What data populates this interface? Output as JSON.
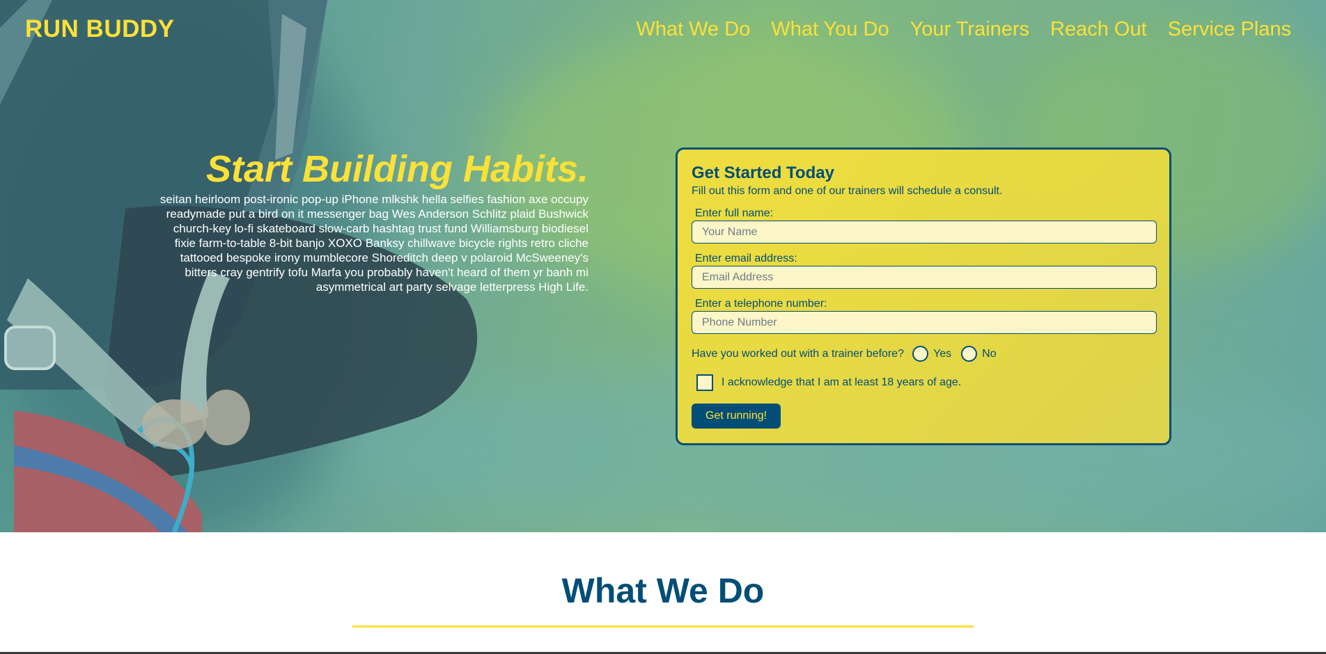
{
  "brand": {
    "logo_text": "RUN BUDDY",
    "accent_color": "#fce138",
    "primary_color": "#024e76"
  },
  "nav": {
    "items": [
      {
        "label": "What We Do"
      },
      {
        "label": "What You Do"
      },
      {
        "label": "Your Trainers"
      },
      {
        "label": "Reach Out"
      },
      {
        "label": "Service Plans"
      }
    ]
  },
  "hero": {
    "image_icon": "runner-tying-shoe-photo",
    "headline": "Start Building Habits.",
    "body": "seitan heirloom post-ironic pop-up iPhone mlkshk hella selfies fashion axe occupy readymade put a bird on it messenger bag Wes Anderson Schlitz plaid Bushwick church-key lo-fi skateboard slow-carb hashtag trust fund Williamsburg biodiesel fixie farm-to-table 8-bit banjo XOXO Banksy chillwave bicycle rights retro cliche tattooed bespoke irony mumblecore Shoreditch deep v polaroid McSweeney's bitters cray gentrify tofu Marfa you probably haven't heard of them yr banh mi asymmetrical art party selvage letterpress High Life."
  },
  "form": {
    "title": "Get Started Today",
    "subtitle": "Fill out this form and one of our trainers will schedule a consult.",
    "name_label": "Enter full name:",
    "name_placeholder": "Your Name",
    "name_value": "",
    "email_label": "Enter email address:",
    "email_placeholder": "Email Address",
    "email_value": "",
    "phone_label": "Enter a telephone number:",
    "phone_placeholder": "Phone Number",
    "phone_value": "",
    "trainer_question": "Have you worked out with a trainer before?",
    "radio_yes": "Yes",
    "radio_no": "No",
    "age_ack": "I acknowledge that I am at least 18 years of age.",
    "submit_label": "Get running!"
  },
  "section": {
    "title": "What We Do"
  }
}
